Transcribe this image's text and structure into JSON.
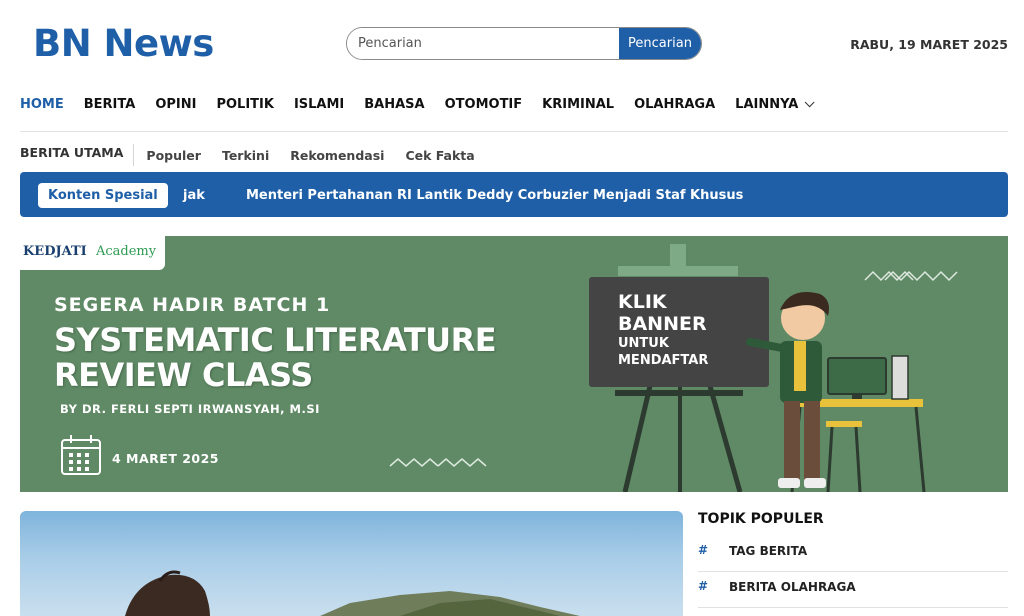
{
  "header": {
    "logo": "BN News",
    "search_placeholder": "Pencarian",
    "search_button": "Pencarian",
    "date": "RABU, 19 MARET 2025"
  },
  "main_nav": [
    {
      "label": "HOME",
      "active": true
    },
    {
      "label": "BERITA"
    },
    {
      "label": "OPINI"
    },
    {
      "label": "POLITIK"
    },
    {
      "label": "ISLAMI"
    },
    {
      "label": "BAHASA"
    },
    {
      "label": "OTOMOTIF"
    },
    {
      "label": "KRIMINAL"
    },
    {
      "label": "OLAHRAGA"
    },
    {
      "label": "LAINNYA",
      "has_dropdown": true
    }
  ],
  "sub_nav": {
    "title": "BERITA UTAMA",
    "items": [
      "Populer",
      "Terkini",
      "Rekomendasi",
      "Cek Fakta"
    ]
  },
  "ticker": {
    "label": "Konten Spesial",
    "fragment": "jak",
    "headline": "Menteri Pertahanan RI Lantik Deddy Corbuzier Menjadi Staf Khusus"
  },
  "banner": {
    "brand_primary": "KEDJATI",
    "brand_secondary": "Academy",
    "batch": "SEGERA HADIR BATCH 1",
    "title_line1": "SYSTEMATIC LITERATURE",
    "title_line2": "REVIEW CLASS",
    "by": "BY DR. FERLI SEPTI IRWANSYAH, M.SI",
    "date": "4 MARET 2025",
    "board_line1": "KLIK",
    "board_line2": "BANNER",
    "board_line3": "UNTUK",
    "board_line4": "MENDAFTAR"
  },
  "sidebar": {
    "title": "TOPIK POPULER",
    "items": [
      {
        "hash": "#",
        "label": "TAG BERITA"
      },
      {
        "hash": "#",
        "label": "BERITA OLAHRAGA"
      }
    ]
  },
  "colors": {
    "brand_blue": "#1f5fa8",
    "banner_green": "#5f8a65",
    "board_dark": "#444444"
  }
}
